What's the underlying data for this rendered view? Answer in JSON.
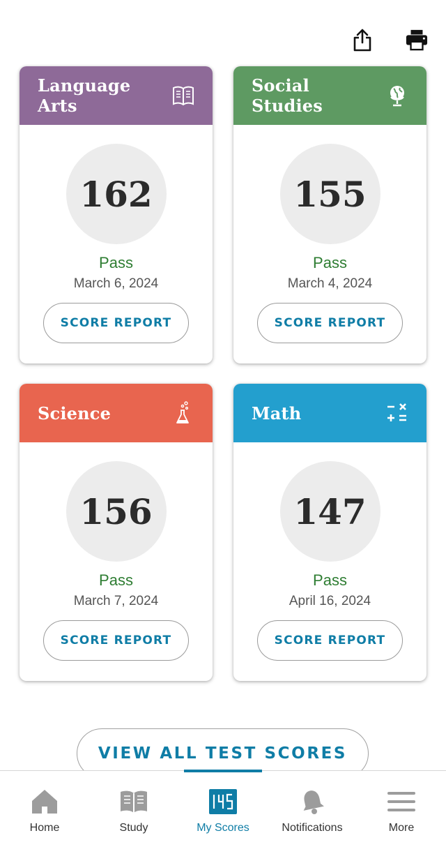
{
  "top_actions": {
    "share_icon": "share-icon",
    "print_icon": "print-icon"
  },
  "cards": [
    {
      "title": "Language Arts",
      "icon": "book-icon",
      "color": "#8e6a98",
      "score": "162",
      "status": "Pass",
      "date": "March 6, 2024",
      "button": "SCORE REPORT"
    },
    {
      "title": "Social Studies",
      "icon": "globe-icon",
      "color": "#5e9a62",
      "score": "155",
      "status": "Pass",
      "date": "March 4, 2024",
      "button": "SCORE REPORT"
    },
    {
      "title": "Science",
      "icon": "flask-icon",
      "color": "#e8654f",
      "score": "156",
      "status": "Pass",
      "date": "March 7, 2024",
      "button": "SCORE REPORT"
    },
    {
      "title": "Math",
      "icon": "math-operators-icon",
      "color": "#239fce",
      "score": "147",
      "status": "Pass",
      "date": "April 16, 2024",
      "button": "SCORE REPORT"
    }
  ],
  "view_all": "VIEW ALL TEST SCORES",
  "colors": {
    "accent": "#0f7da6",
    "pass": "#2e7d32"
  },
  "nav": [
    {
      "label": "Home",
      "icon": "home-icon",
      "active": false
    },
    {
      "label": "Study",
      "icon": "study-book-icon",
      "active": false
    },
    {
      "label": "My Scores",
      "icon": "scoreboard-icon",
      "active": true
    },
    {
      "label": "Notifications",
      "icon": "bell-icon",
      "active": false
    },
    {
      "label": "More",
      "icon": "menu-icon",
      "active": false
    }
  ]
}
